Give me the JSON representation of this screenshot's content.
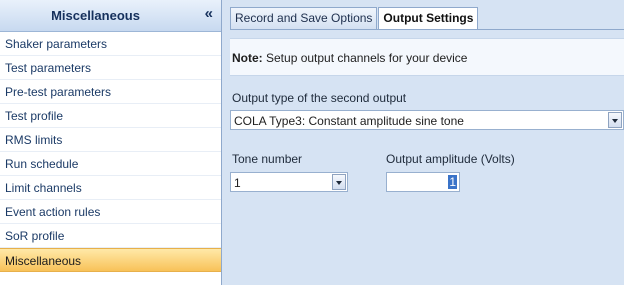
{
  "sidebar": {
    "title": "Miscellaneous",
    "collapse_glyph": "«",
    "items": [
      {
        "label": "Shaker parameters"
      },
      {
        "label": "Test parameters"
      },
      {
        "label": "Pre-test parameters"
      },
      {
        "label": "Test profile"
      },
      {
        "label": "RMS limits"
      },
      {
        "label": "Run schedule"
      },
      {
        "label": "Limit channels"
      },
      {
        "label": "Event action rules"
      },
      {
        "label": "SoR profile"
      },
      {
        "label": "Miscellaneous",
        "active": true
      }
    ]
  },
  "tabs": [
    {
      "label": "Record and Save Options"
    },
    {
      "label": "Output Settings",
      "active": true
    }
  ],
  "note": {
    "prefix": "Note:",
    "text": " Setup output channels for your device"
  },
  "output_type": {
    "label": "Output type of the second output",
    "value": "COLA Type3: Constant amplitude sine tone"
  },
  "tone_number": {
    "label": "Tone number",
    "value": "1"
  },
  "output_amplitude": {
    "label": "Output amplitude (Volts)",
    "value": "1"
  },
  "colors": {
    "accent_active": "#f8c259",
    "panel_bg": "#d6e3f3",
    "selection": "#3a73c8"
  }
}
